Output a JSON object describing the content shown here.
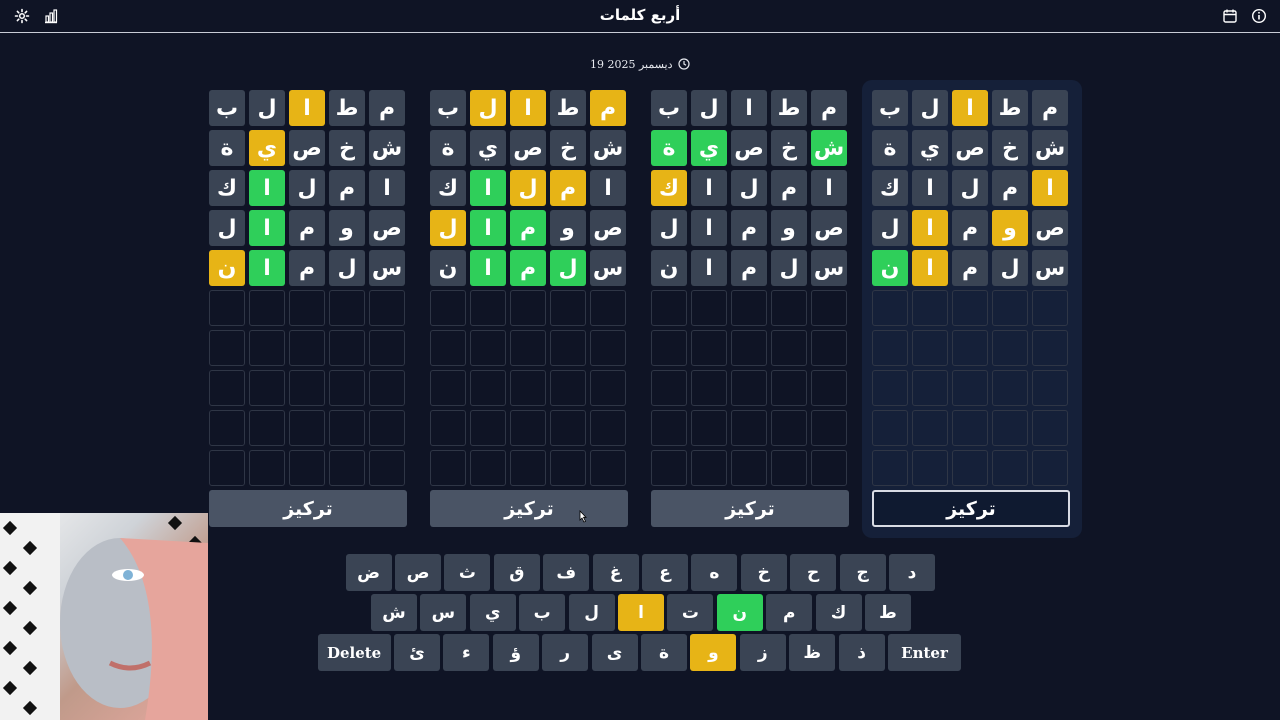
{
  "header": {
    "title": "أربع كلمات"
  },
  "date": "19 ديسمبر 2025",
  "colors": {
    "gray": "#3a4454",
    "yellow": "#e7b416",
    "green": "#2fcf5a",
    "background": "#0f1425"
  },
  "boards": [
    {
      "focus_label": "تركيز",
      "active": false,
      "rows": [
        [
          {
            "l": "م",
            "s": "g"
          },
          {
            "l": "ط",
            "s": "g"
          },
          {
            "l": "ا",
            "s": "y"
          },
          {
            "l": "ل",
            "s": "g"
          },
          {
            "l": "ب",
            "s": "g"
          }
        ],
        [
          {
            "l": "ش",
            "s": "g"
          },
          {
            "l": "خ",
            "s": "g"
          },
          {
            "l": "ص",
            "s": "g"
          },
          {
            "l": "ي",
            "s": "y"
          },
          {
            "l": "ة",
            "s": "g"
          }
        ],
        [
          {
            "l": "ا",
            "s": "g"
          },
          {
            "l": "م",
            "s": "g"
          },
          {
            "l": "ل",
            "s": "g"
          },
          {
            "l": "ا",
            "s": "gr"
          },
          {
            "l": "ك",
            "s": "g"
          }
        ],
        [
          {
            "l": "ص",
            "s": "g"
          },
          {
            "l": "و",
            "s": "g"
          },
          {
            "l": "م",
            "s": "g"
          },
          {
            "l": "ا",
            "s": "gr"
          },
          {
            "l": "ل",
            "s": "g"
          }
        ],
        [
          {
            "l": "س",
            "s": "g"
          },
          {
            "l": "ل",
            "s": "g"
          },
          {
            "l": "م",
            "s": "g"
          },
          {
            "l": "ا",
            "s": "gr"
          },
          {
            "l": "ن",
            "s": "y"
          }
        ]
      ]
    },
    {
      "focus_label": "تركيز",
      "active": false,
      "rows": [
        [
          {
            "l": "م",
            "s": "y"
          },
          {
            "l": "ط",
            "s": "g"
          },
          {
            "l": "ا",
            "s": "y"
          },
          {
            "l": "ل",
            "s": "y"
          },
          {
            "l": "ب",
            "s": "g"
          }
        ],
        [
          {
            "l": "ش",
            "s": "g"
          },
          {
            "l": "خ",
            "s": "g"
          },
          {
            "l": "ص",
            "s": "g"
          },
          {
            "l": "ي",
            "s": "g"
          },
          {
            "l": "ة",
            "s": "g"
          }
        ],
        [
          {
            "l": "ا",
            "s": "g"
          },
          {
            "l": "م",
            "s": "y"
          },
          {
            "l": "ل",
            "s": "y"
          },
          {
            "l": "ا",
            "s": "gr"
          },
          {
            "l": "ك",
            "s": "g"
          }
        ],
        [
          {
            "l": "ص",
            "s": "g"
          },
          {
            "l": "و",
            "s": "g"
          },
          {
            "l": "م",
            "s": "gr"
          },
          {
            "l": "ا",
            "s": "gr"
          },
          {
            "l": "ل",
            "s": "y"
          }
        ],
        [
          {
            "l": "س",
            "s": "g"
          },
          {
            "l": "ل",
            "s": "gr"
          },
          {
            "l": "م",
            "s": "gr"
          },
          {
            "l": "ا",
            "s": "gr"
          },
          {
            "l": "ن",
            "s": "g"
          }
        ]
      ]
    },
    {
      "focus_label": "تركيز",
      "active": false,
      "rows": [
        [
          {
            "l": "م",
            "s": "g"
          },
          {
            "l": "ط",
            "s": "g"
          },
          {
            "l": "ا",
            "s": "g"
          },
          {
            "l": "ل",
            "s": "g"
          },
          {
            "l": "ب",
            "s": "g"
          }
        ],
        [
          {
            "l": "ش",
            "s": "gr"
          },
          {
            "l": "خ",
            "s": "g"
          },
          {
            "l": "ص",
            "s": "g"
          },
          {
            "l": "ي",
            "s": "gr"
          },
          {
            "l": "ة",
            "s": "gr"
          }
        ],
        [
          {
            "l": "ا",
            "s": "g"
          },
          {
            "l": "م",
            "s": "g"
          },
          {
            "l": "ل",
            "s": "g"
          },
          {
            "l": "ا",
            "s": "g"
          },
          {
            "l": "ك",
            "s": "y"
          }
        ],
        [
          {
            "l": "ص",
            "s": "g"
          },
          {
            "l": "و",
            "s": "g"
          },
          {
            "l": "م",
            "s": "g"
          },
          {
            "l": "ا",
            "s": "g"
          },
          {
            "l": "ل",
            "s": "g"
          }
        ],
        [
          {
            "l": "س",
            "s": "g"
          },
          {
            "l": "ل",
            "s": "g"
          },
          {
            "l": "م",
            "s": "g"
          },
          {
            "l": "ا",
            "s": "g"
          },
          {
            "l": "ن",
            "s": "g"
          }
        ]
      ]
    },
    {
      "focus_label": "تركيز",
      "active": true,
      "rows": [
        [
          {
            "l": "م",
            "s": "g"
          },
          {
            "l": "ط",
            "s": "g"
          },
          {
            "l": "ا",
            "s": "y"
          },
          {
            "l": "ل",
            "s": "g"
          },
          {
            "l": "ب",
            "s": "g"
          }
        ],
        [
          {
            "l": "ش",
            "s": "g"
          },
          {
            "l": "خ",
            "s": "g"
          },
          {
            "l": "ص",
            "s": "g"
          },
          {
            "l": "ي",
            "s": "g"
          },
          {
            "l": "ة",
            "s": "g"
          }
        ],
        [
          {
            "l": "ا",
            "s": "y"
          },
          {
            "l": "م",
            "s": "g"
          },
          {
            "l": "ل",
            "s": "g"
          },
          {
            "l": "ا",
            "s": "g"
          },
          {
            "l": "ك",
            "s": "g"
          }
        ],
        [
          {
            "l": "ص",
            "s": "g"
          },
          {
            "l": "و",
            "s": "y"
          },
          {
            "l": "م",
            "s": "g"
          },
          {
            "l": "ا",
            "s": "y"
          },
          {
            "l": "ل",
            "s": "g"
          }
        ],
        [
          {
            "l": "س",
            "s": "g"
          },
          {
            "l": "ل",
            "s": "g"
          },
          {
            "l": "م",
            "s": "g"
          },
          {
            "l": "ا",
            "s": "y"
          },
          {
            "l": "ن",
            "s": "gr"
          }
        ]
      ]
    }
  ],
  "keyboard": {
    "row1": [
      {
        "k": "د",
        "s": "g"
      },
      {
        "k": "ج",
        "s": "g"
      },
      {
        "k": "ح",
        "s": "g"
      },
      {
        "k": "خ",
        "s": "g"
      },
      {
        "k": "ه",
        "s": "g"
      },
      {
        "k": "ع",
        "s": "g"
      },
      {
        "k": "غ",
        "s": "g"
      },
      {
        "k": "ف",
        "s": "g"
      },
      {
        "k": "ق",
        "s": "g"
      },
      {
        "k": "ث",
        "s": "g"
      },
      {
        "k": "ص",
        "s": "g"
      },
      {
        "k": "ض",
        "s": "g"
      }
    ],
    "row2": [
      {
        "k": "ط",
        "s": "g"
      },
      {
        "k": "ك",
        "s": "g"
      },
      {
        "k": "م",
        "s": "g"
      },
      {
        "k": "ن",
        "s": "gr"
      },
      {
        "k": "ت",
        "s": "g"
      },
      {
        "k": "ا",
        "s": "y"
      },
      {
        "k": "ل",
        "s": "g"
      },
      {
        "k": "ب",
        "s": "g"
      },
      {
        "k": "ي",
        "s": "g"
      },
      {
        "k": "س",
        "s": "g"
      },
      {
        "k": "ش",
        "s": "g"
      }
    ],
    "row3": [
      {
        "k": "Enter",
        "s": "g"
      },
      {
        "k": "ذ",
        "s": "g"
      },
      {
        "k": "ظ",
        "s": "g"
      },
      {
        "k": "ز",
        "s": "g"
      },
      {
        "k": "و",
        "s": "y"
      },
      {
        "k": "ة",
        "s": "g"
      },
      {
        "k": "ى",
        "s": "g"
      },
      {
        "k": "ر",
        "s": "g"
      },
      {
        "k": "ؤ",
        "s": "g"
      },
      {
        "k": "ء",
        "s": "g"
      },
      {
        "k": "ئ",
        "s": "g"
      },
      {
        "k": "Delete",
        "s": "g"
      }
    ]
  }
}
